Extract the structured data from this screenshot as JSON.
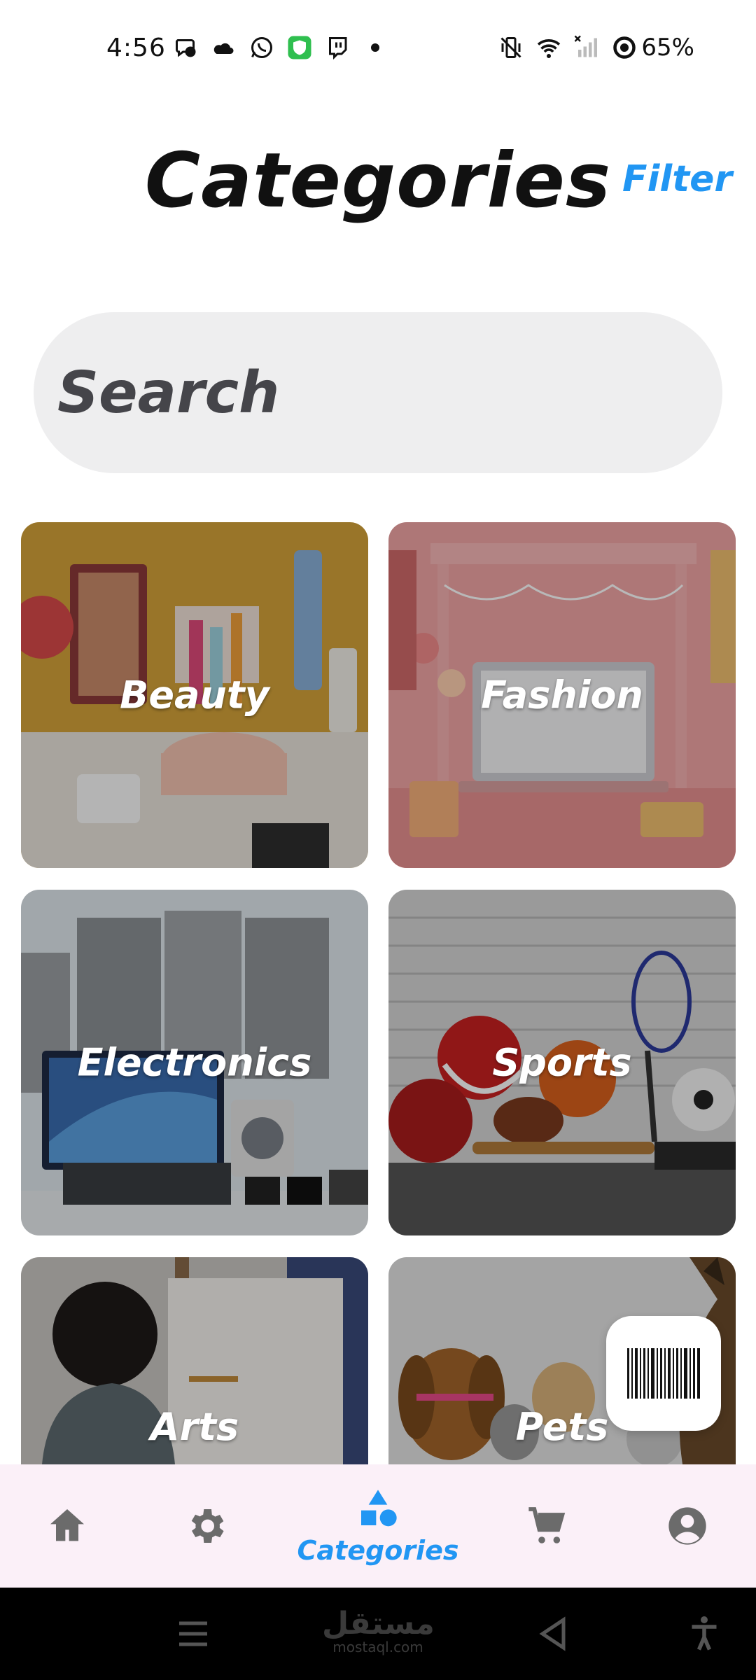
{
  "status_bar": {
    "time": "4:56",
    "battery": "65%",
    "icons_left": [
      "messenger-icon",
      "weather-icon",
      "whatsapp-icon",
      "vpn-shield-icon",
      "twitch-icon",
      "dot-icon"
    ],
    "icons_right": [
      "vibrate-off-icon",
      "wifi-icon",
      "signal-icon",
      "battery-icon"
    ]
  },
  "header": {
    "title": "Categories",
    "filter_label": "Filter"
  },
  "search": {
    "placeholder": "Search"
  },
  "categories": [
    {
      "label": "Beauty"
    },
    {
      "label": "Fashion"
    },
    {
      "label": "Electronics"
    },
    {
      "label": "Sports"
    },
    {
      "label": "Arts"
    },
    {
      "label": "Pets"
    }
  ],
  "bottom_nav": {
    "active_label": "Categories",
    "items": [
      "home-icon",
      "settings-icon",
      "categories-icon",
      "cart-icon",
      "profile-icon"
    ],
    "active_color": "#2196f3",
    "inactive_color": "#6b6b6b"
  },
  "watermark": {
    "brand": "مستقل",
    "domain": "mostaql.com"
  },
  "colors": {
    "accent": "#2196f3",
    "search_bg": "#eeeeef",
    "nav_bg": "#fbf0f8"
  }
}
